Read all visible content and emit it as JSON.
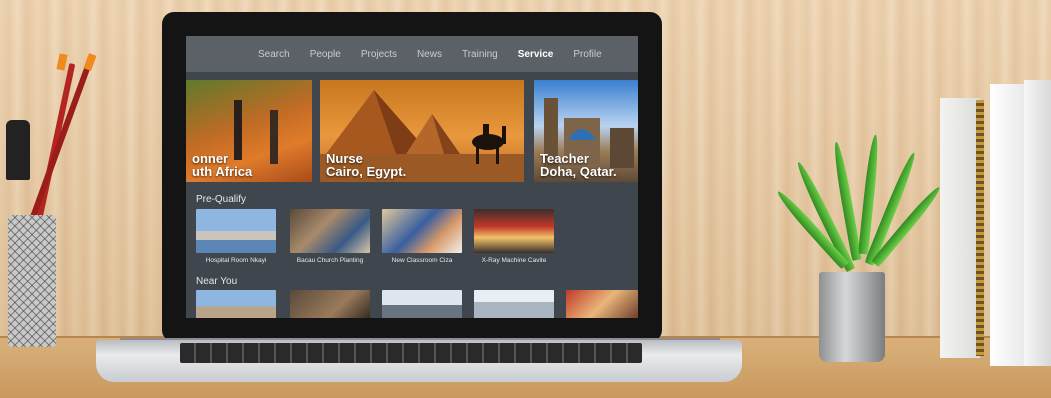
{
  "nav": {
    "items": [
      {
        "label": "Search"
      },
      {
        "label": "People"
      },
      {
        "label": "Projects"
      },
      {
        "label": "News"
      },
      {
        "label": "Training"
      },
      {
        "label": "Service",
        "active": true
      },
      {
        "label": "Profile"
      }
    ]
  },
  "featured": [
    {
      "title": "onner\nuth Africa"
    },
    {
      "title": "Nurse\nCairo, Egypt."
    },
    {
      "title": "Teacher\nDoha, Qatar."
    }
  ],
  "sections": {
    "pre_qualify": {
      "heading": "Pre-Qualify",
      "items": [
        {
          "caption": "Hospital Room Nkayi"
        },
        {
          "caption": "Bacau Church Planting"
        },
        {
          "caption": "New Classroom Ciza"
        },
        {
          "caption": "X-Ray Machine Cavite"
        }
      ]
    },
    "near_you": {
      "heading": "Near You"
    }
  },
  "colors": {
    "app_background": "#40464d",
    "nav_background": "#5c6168",
    "active_nav": "#ffffff"
  }
}
